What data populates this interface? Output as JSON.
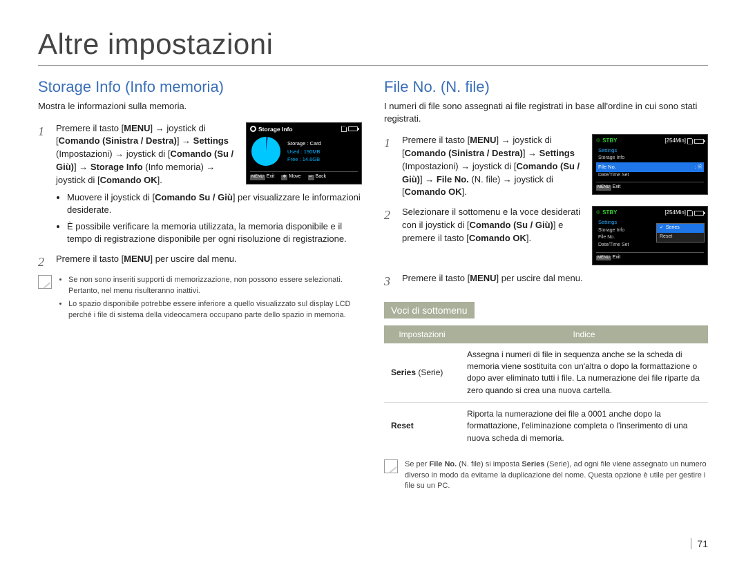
{
  "page_title": "Altre impostazioni",
  "page_number": "71",
  "left": {
    "heading": "Storage Info (Info memoria)",
    "intro": "Mostra le informazioni sulla memoria.",
    "step1_html": "Premere il tasto [<b>MENU</b>] → joystick di [<b>Comando (Sinistra / Destra)</b>] → <b>Settings</b> (Impostazioni) → joystick di [<b>Comando (Su / Giù)</b>] → <b>Storage Info</b> (Info memoria) → joystick di [<b>Comando OK</b>].",
    "step1_bullets": [
      "Muovere il joystick di [<b>Comando Su / Giù</b>] per visualizzare le informazioni desiderate.",
      "È possibile verificare la memoria utilizzata, la memoria disponibile e il tempo di registrazione disponibile per ogni risoluzione di registrazione."
    ],
    "step2_html": "Premere il tasto [<b>MENU</b>] per uscire dal menu.",
    "lcd": {
      "title": "Storage Info",
      "rows": {
        "storage_label": "Storage",
        "storage_value": "Card",
        "used_label": "Used",
        "used_value": "190MB",
        "free_label": "Free",
        "free_value": "14.6GB"
      },
      "exit": "Exit",
      "move": "Move",
      "back": "Back",
      "menu_btn": "MENU"
    },
    "note_items": [
      "Se non sono inseriti supporti di memorizzazione, non possono essere selezionati. Pertanto, nel menu risulteranno inattivi.",
      "Lo spazio disponibile potrebbe essere inferiore a quello visualizzato sul display LCD perché i file di sistema della videocamera occupano parte dello spazio in memoria."
    ]
  },
  "right": {
    "heading": "File No. (N. file)",
    "intro": "I numeri di file sono assegnati ai file registrati in base all'ordine in cui sono stati registrati.",
    "step1_html": "Premere il tasto [<b>MENU</b>] → joystick di [<b>Comando (Sinistra / Destra)</b>] → <b>Settings</b> (Impostazioni) → joystick di [<b>Comando (Su / Giù)</b>] → <b>File No.</b> (N. file) → joystick di [<b>Comando OK</b>].",
    "step2_html": "Selezionare il sottomenu e la voce desiderati con il joystick di [<b>Comando (Su / Giù)</b>] e premere il tasto [<b>Comando OK</b>].",
    "step3_html": "Premere il tasto [<b>MENU</b>] per uscire dal menu.",
    "lcd_common": {
      "stby": "STBY",
      "time": "[254Min]",
      "settings": "Settings",
      "storage_info": "Storage Info",
      "file_no": "File No.",
      "date_time": "Date/Time Set",
      "exit": "Exit",
      "menu_btn": "MENU"
    },
    "lcd2": {
      "series": "Series",
      "reset": "Reset"
    },
    "subhead": "Voci di sottomenu",
    "table": {
      "th1": "Impostazioni",
      "th2": "Indice",
      "row1_label_html": "<b>Series</b> (Serie)",
      "row1_desc": "Assegna i numeri di file in sequenza anche se la scheda di memoria viene sostituita con un'altra o dopo la formattazione o dopo aver eliminato tutti i file. La numerazione dei file riparte da zero quando si crea una nuova cartella.",
      "row2_label_html": "<b>Reset</b>",
      "row2_desc": "Riporta la numerazione dei file a 0001 anche dopo la formattazione, l'eliminazione completa o l'inserimento di una nuova scheda di memoria."
    },
    "note_html": "Se per <b>File No.</b> (N. file) si imposta <b>Series</b> (Serie), ad ogni file viene assegnato un numero diverso in modo da evitarne la duplicazione del nome. Questa opzione è utile per gestire i file su un PC."
  }
}
